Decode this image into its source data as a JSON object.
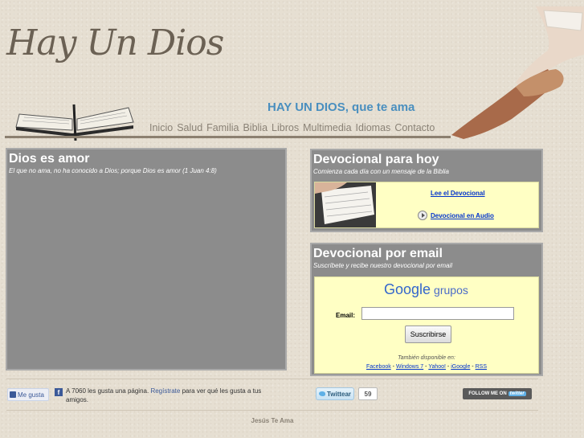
{
  "header": {
    "logo": "Hay Un Dios",
    "tagline": "HAY UN DIOS, que te ama"
  },
  "nav": {
    "items": [
      "Inicio",
      "Salud",
      "Familia",
      "Biblia",
      "Libros",
      "Multimedia",
      "Idiomas",
      "Contacto"
    ]
  },
  "main_panel": {
    "title": "Dios es amor",
    "subtitle": "El que no ama, no ha conocido a Dios; porque Dios es amor (1 Juan 4:8)"
  },
  "devocional": {
    "title": "Devocional para hoy",
    "subtitle": "Comienza cada día con un mensaje de la Biblia",
    "read_link": "Lee el Devocional",
    "audio_link": "Devocional en Audio"
  },
  "email_panel": {
    "title": "Devocional por email",
    "subtitle": "Suscríbete y recibe nuestro devocional por email",
    "google_word": "Google",
    "groups_word": "grupos",
    "email_label": "Email:",
    "subscribe_label": "Suscribirse",
    "available_text": "También disponible en:",
    "feeds": [
      "Facebook",
      "Windows 7",
      "Yahoo!",
      "iGoogle",
      "RSS"
    ]
  },
  "social": {
    "like_label": "Me gusta",
    "fb_text_prefix": "A 7060 les gusta una página.",
    "fb_register": "Regístrate",
    "fb_text_suffix": "para ver qué les gusta a tus amigos.",
    "tweet_label": "Twittear",
    "tweet_count": "59",
    "follow_prefix": "FOLLOW ME ON",
    "follow_brand": "twitter"
  },
  "footer": {
    "text": "Jesús Te Ama"
  },
  "colors": {
    "tagline": "#4a8fbf",
    "panel_gray": "#8c8c8c",
    "inner_yellow": "#ffffc4",
    "link_blue": "#0033cc"
  }
}
